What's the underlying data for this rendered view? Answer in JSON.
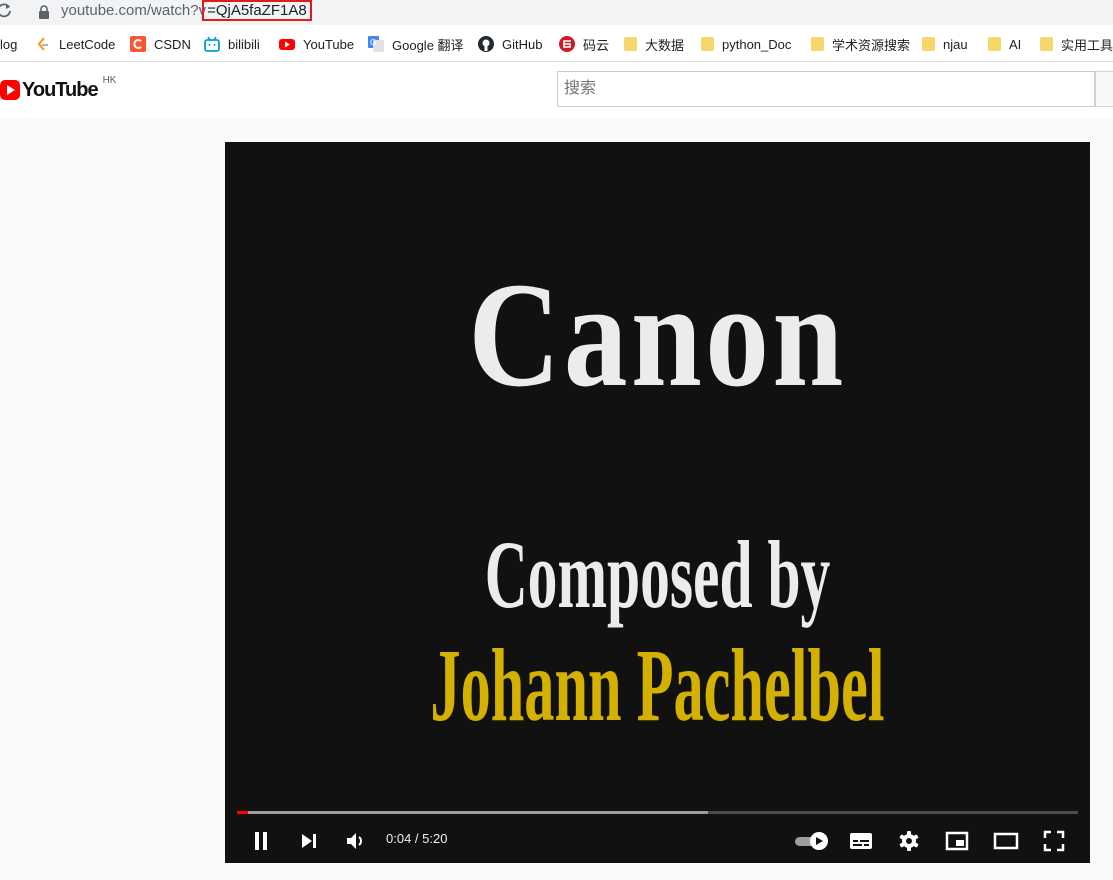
{
  "browser": {
    "url_base": "youtube.com/watch?v",
    "url_video_id": "=QjA5faZF1A8"
  },
  "bookmarks": [
    {
      "label": "log",
      "icon": "blog-icon"
    },
    {
      "label": "LeetCode",
      "icon": "leetcode-icon"
    },
    {
      "label": "CSDN",
      "icon": "csdn-icon"
    },
    {
      "label": "bilibili",
      "icon": "bilibili-icon"
    },
    {
      "label": "YouTube",
      "icon": "youtube-icon"
    },
    {
      "label": "Google 翻译",
      "icon": "google-translate-icon"
    },
    {
      "label": "GitHub",
      "icon": "github-icon"
    },
    {
      "label": "码云",
      "icon": "gitee-icon"
    },
    {
      "label": "大数据",
      "icon": "folder-icon"
    },
    {
      "label": "python_Doc",
      "icon": "folder-icon"
    },
    {
      "label": "学术资源搜索",
      "icon": "folder-icon"
    },
    {
      "label": "njau",
      "icon": "folder-icon"
    },
    {
      "label": "AI",
      "icon": "folder-icon"
    },
    {
      "label": "实用工具",
      "icon": "folder-icon"
    }
  ],
  "header": {
    "logo_text": "YouTube",
    "region": "HK",
    "search_placeholder": "搜索"
  },
  "video": {
    "line1": "Canon",
    "line2": "Composed by",
    "line3": "Johann Pachelbel",
    "current_time": "0:04",
    "duration": "5:20",
    "time_display": "0:04 / 5:20",
    "played_fraction": 0.0125,
    "buffered_fraction": 0.56
  },
  "colors": {
    "accent": "#ff0000",
    "composer_text": "#d4b000",
    "url_highlight": "#e01b1b"
  }
}
